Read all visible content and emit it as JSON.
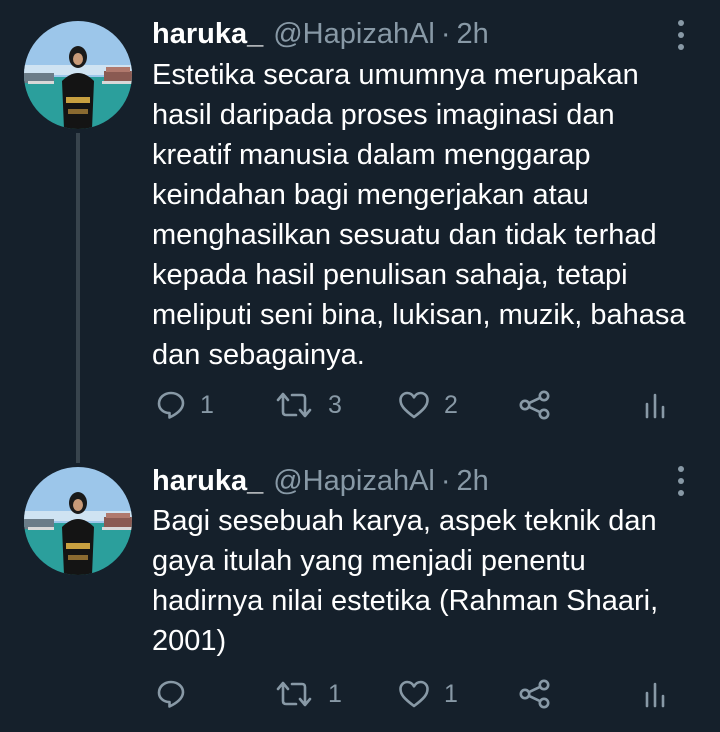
{
  "colors": {
    "background": "#15202b",
    "text_primary": "#ffffff",
    "text_secondary": "#8899a6",
    "thread_line": "#38444d"
  },
  "tweets": [
    {
      "author_name": "haruka_",
      "handle": "@HapizahAl",
      "separator": "·",
      "time": "2h",
      "lines": [
        "Estetika secara umumnya merupakan",
        "hasil daripada proses imaginasi dan",
        "kreatif manusia dalam menggarap",
        "keindahan bagi mengerjakan atau",
        "menghasilkan sesuatu dan tidak terhad",
        "kepada hasil penulisan sahaja, tetapi",
        "meliputi seni bina, lukisan, muzik, bahasa",
        "dan sebagainya."
      ],
      "reply_count": "1",
      "retweet_count": "3",
      "like_count": "2"
    },
    {
      "author_name": "haruka_",
      "handle": "@HapizahAl",
      "separator": "·",
      "time": "2h",
      "lines": [
        "Bagi sesebuah karya, aspek teknik dan",
        "gaya itulah yang menjadi penentu",
        "hadirnya nilai estetika (Rahman Shaari,",
        "2001)"
      ],
      "reply_count": "",
      "retweet_count": "1",
      "like_count": "1"
    }
  ],
  "icons": {
    "reply": "reply-icon",
    "retweet": "retweet-icon",
    "like": "heart-icon",
    "share": "share-icon",
    "stats": "analytics-icon",
    "more": "more-options-icon"
  }
}
